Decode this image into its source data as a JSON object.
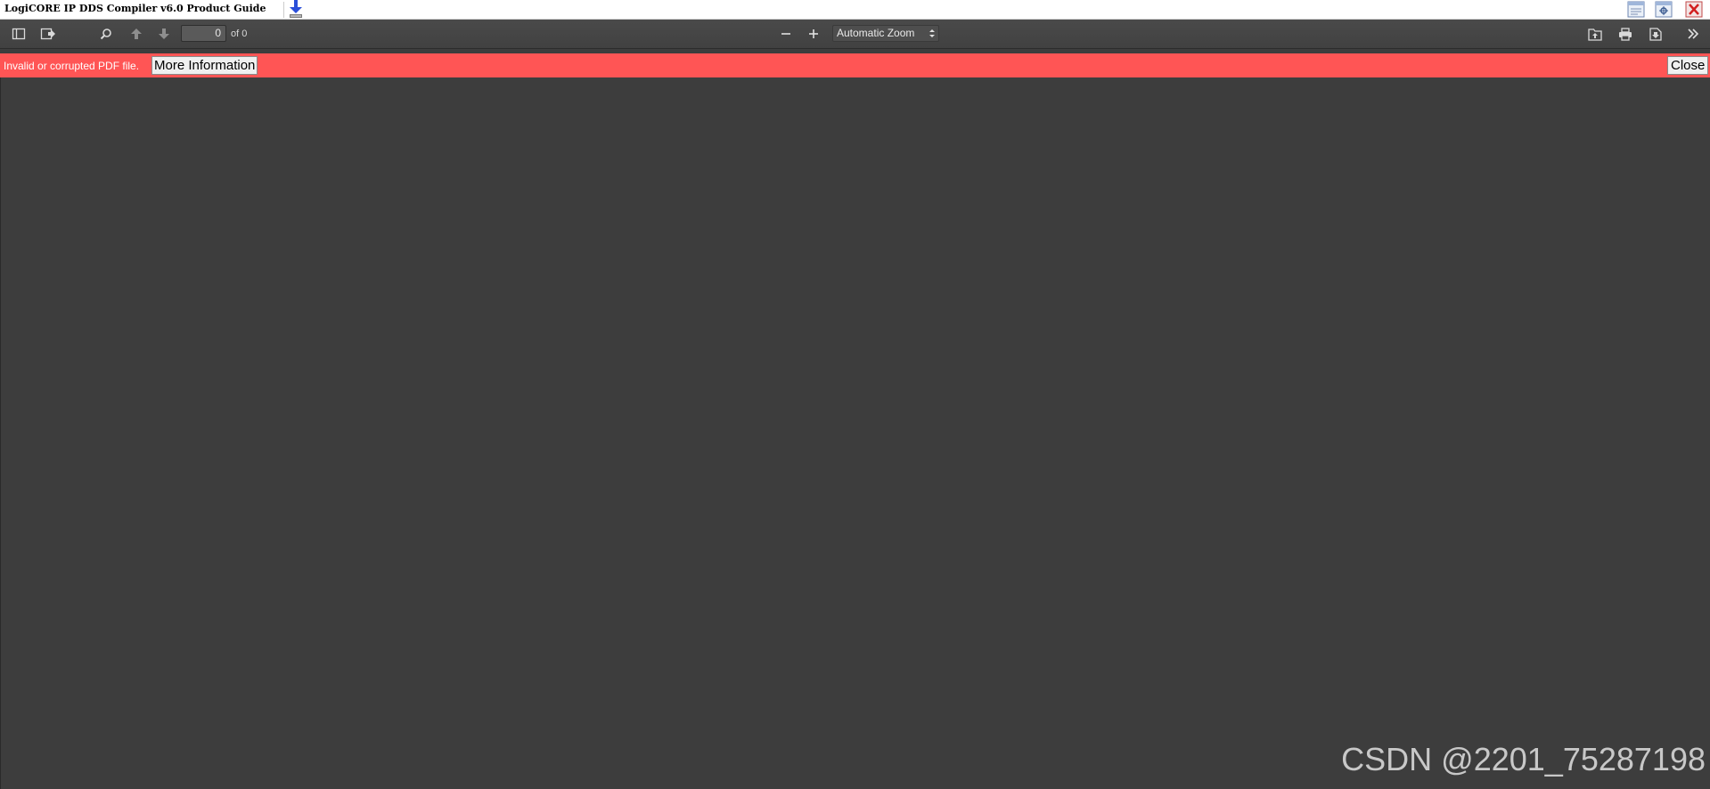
{
  "window": {
    "title": "LogiCORE IP DDS Compiler v6.0 Product Guide",
    "icons": {
      "download": "download-arrow-icon",
      "restore": "window-restore-icon",
      "settings": "window-settings-icon",
      "close": "window-close-icon"
    }
  },
  "toolbar": {
    "sidebar_toggle_icon": "sidebar-toggle-icon",
    "outline_icon": "document-outline-icon",
    "find_icon": "search-icon",
    "previous_icon": "arrow-up-icon",
    "next_icon": "arrow-down-icon",
    "page_number": "0",
    "page_count": "of 0",
    "zoom_out_icon": "minus-icon",
    "zoom_in_icon": "plus-icon",
    "zoom_value": "Automatic Zoom",
    "open_file_icon": "open-file-icon",
    "print_icon": "print-icon",
    "download_icon": "save-icon",
    "tools_icon": "double-chevron-right-icon"
  },
  "error_bar": {
    "message": "Invalid or corrupted PDF file.",
    "more_info_label": "More Information",
    "close_label": "Close",
    "color": "#ff5555"
  },
  "watermark": {
    "text": "CSDN @2201_75287198"
  },
  "colors": {
    "toolbar_bg": "#474747",
    "viewer_bg": "#3d3d3d"
  }
}
